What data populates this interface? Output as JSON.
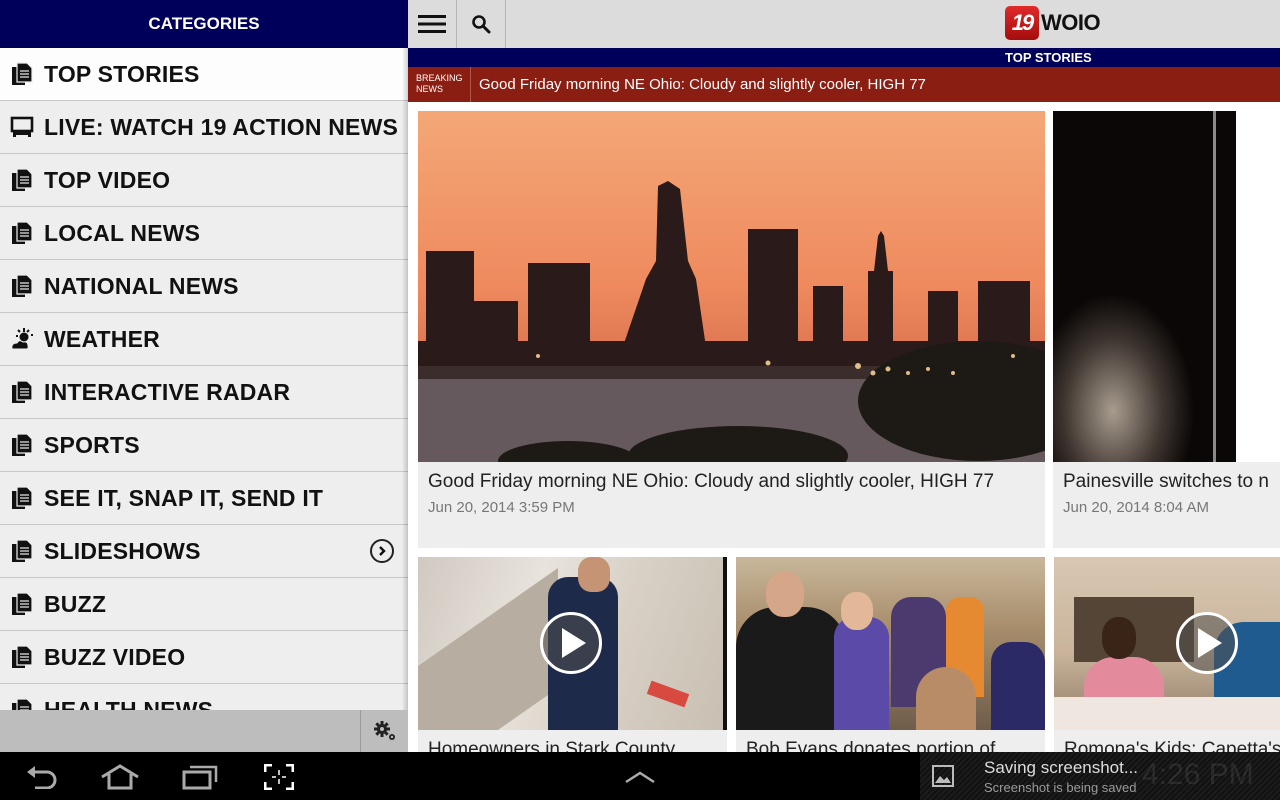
{
  "app": {
    "brand": {
      "badge": "19",
      "name": "WOIO"
    },
    "section_title": "TOP STORIES",
    "breaking": {
      "label_line1": "BREAKING",
      "label_line2": "NEWS",
      "text": "Good Friday morning NE Ohio: Cloudy and slightly cooler, HIGH 77"
    },
    "toolbar": {
      "menu_icon": "hamburger-menu-icon",
      "search_icon": "search-icon"
    }
  },
  "sidebar": {
    "header": "CATEGORIES",
    "items": [
      {
        "label": "TOP STORIES",
        "icon": "documents-icon",
        "active": true
      },
      {
        "label": "LIVE: WATCH 19 ACTION NEWS",
        "icon": "monitor-icon"
      },
      {
        "label": "TOP VIDEO",
        "icon": "documents-icon"
      },
      {
        "label": "LOCAL NEWS",
        "icon": "documents-icon"
      },
      {
        "label": "NATIONAL NEWS",
        "icon": "documents-icon"
      },
      {
        "label": "WEATHER",
        "icon": "weather-sun-cloud-icon"
      },
      {
        "label": "INTERACTIVE RADAR",
        "icon": "documents-icon"
      },
      {
        "label": "SPORTS",
        "icon": "documents-icon"
      },
      {
        "label": "SEE IT, SNAP IT, SEND IT",
        "icon": "documents-icon"
      },
      {
        "label": "SLIDESHOWS",
        "icon": "documents-icon",
        "has_submenu": true
      },
      {
        "label": "BUZZ",
        "icon": "documents-icon"
      },
      {
        "label": "BUZZ VIDEO",
        "icon": "documents-icon"
      },
      {
        "label": "HEALTH NEWS",
        "icon": "documents-icon"
      }
    ],
    "footer_icon": "settings-gears-icon"
  },
  "stories": [
    {
      "title": "Good Friday morning NE Ohio: Cloudy and slightly cooler, HIGH 77",
      "date": "Jun 20, 2014 3:59 PM",
      "image": "Cleveland skyline at sunset",
      "video": false
    },
    {
      "title": "Painesville switches to n",
      "date": "Jun 20, 2014 8:04 AM",
      "image": "dark blurred photo",
      "video": false
    },
    {
      "title": "Homeowners in Stark County",
      "image": "man carrying drywall",
      "video": true
    },
    {
      "title": "Bob Evans donates portion of",
      "image": "crowd in restaurant bakery",
      "video": false
    },
    {
      "title": "Romona's Kids: Capetta's",
      "image": "two women at table",
      "video": true
    }
  ],
  "system": {
    "nav": [
      "back-icon",
      "home-icon",
      "recent-apps-icon",
      "screenshot-icon",
      "expand-up-icon"
    ],
    "notification": {
      "title": "Saving screenshot...",
      "subtitle": "Screenshot is being saved",
      "clock": "4:26 PM"
    }
  }
}
